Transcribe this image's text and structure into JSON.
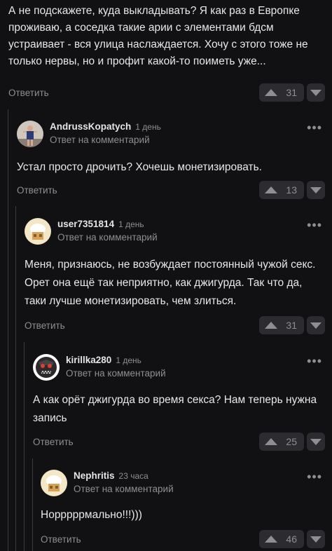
{
  "top_comment": {
    "text": "А не подскажете, куда выкладывать? Я как раз в Европке проживаю, а соседка такие арии с элементами бдсм устраивает - вся улица наслаждается. Хочу с этого тоже не только нервы, но и профит какой-то поиметь уже...",
    "reply_label": "Ответить",
    "score": "31"
  },
  "replies": [
    {
      "author": "AndrussKopatych",
      "time": "1 день",
      "reply_to": "Ответ на комментарий",
      "text": "Устал просто дрочить? Хочешь монетизировать.",
      "reply_label": "Ответить",
      "score": "13",
      "more": "•••"
    },
    {
      "author": "user7351814",
      "time": "1 день",
      "reply_to": "Ответ на комментарий",
      "text": "Меня, признаюсь, не возбуждает постоянный чужой секс. Орет она ещё так неприятно, как джигурда. Так что да, таки лучше монетизировать, чем злиться.",
      "reply_label": "Ответить",
      "score": "31",
      "more": "•••"
    },
    {
      "author": "kirillka280",
      "time": "1 день",
      "reply_to": "Ответ на комментарий",
      "text": "А как орёт джигурда во время секса? Нам теперь нужна запись",
      "reply_label": "Ответить",
      "score": "25",
      "more": "•••"
    },
    {
      "author": "Nephritis",
      "time": "23 часа",
      "reply_to": "Ответ на комментарий",
      "text": "Норррррмально!!!)))",
      "reply_label": "Ответить",
      "score": "46",
      "more": "•••"
    }
  ],
  "colors": {
    "background": "#111113",
    "text": "#e8e8e8",
    "muted": "#8e8e93",
    "button_bg": "#2c2c30"
  }
}
